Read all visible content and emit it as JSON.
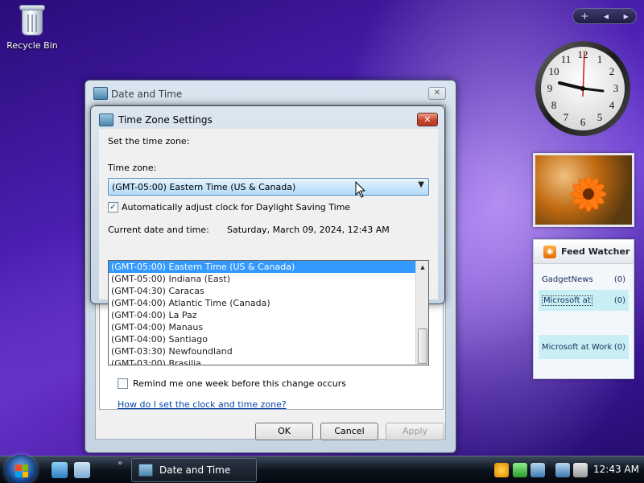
{
  "desktop": {
    "recycle_bin_label": "Recycle Bin"
  },
  "gadget_bar": {
    "add_symbol": "+",
    "prev_symbol": "◂",
    "next_symbol": "▸"
  },
  "clock_gadget": {
    "numbers": [
      "12",
      "1",
      "2",
      "3",
      "4",
      "5",
      "6",
      "7",
      "8",
      "9",
      "10",
      "11"
    ]
  },
  "feed_watcher": {
    "title": "Feed Watcher",
    "feeds": [
      {
        "name": "GadgetNews",
        "count": "(0)"
      },
      {
        "name": "Microsoft at",
        "count": "(0)"
      },
      {
        "name": "",
        "count": ""
      },
      {
        "name": "Microsoft at Work",
        "count": "(0)"
      }
    ]
  },
  "date_time_window": {
    "title": "Date and Time",
    "close_symbol": "✕",
    "remind_label": "Remind me one week before this change occurs",
    "help_link": "How do I set the clock and time zone?",
    "ok_label": "OK",
    "cancel_label": "Cancel",
    "apply_label": "Apply"
  },
  "time_zone_dialog": {
    "title": "Time Zone Settings",
    "close_symbol": "✕",
    "set_time_zone_label": "Set the time zone:",
    "time_zone_label": "Time zone:",
    "selected_zone": "(GMT-05:00) Eastern Time (US & Canada)",
    "dropdown_arrow": "▼",
    "dst_label": "Automatically adjust clock for Daylight Saving Time",
    "dst_checked": "✓",
    "current_label": "Current date and time:",
    "current_value": "Saturday, March 09, 2024, 12:43 AM",
    "zones": [
      "(GMT-05:00) Eastern Time (US & Canada)",
      "(GMT-05:00) Indiana (East)",
      "(GMT-04:30) Caracas",
      "(GMT-04:00) Atlantic Time (Canada)",
      "(GMT-04:00) La Paz",
      "(GMT-04:00) Manaus",
      "(GMT-04:00) Santiago",
      "(GMT-03:30) Newfoundland",
      "(GMT-03:00) Brasilia"
    ],
    "scroll_up_symbol": "▲"
  },
  "taskbar": {
    "overflow_symbol": "»",
    "active_task": "Date and Time",
    "clock": "12:43 AM"
  }
}
